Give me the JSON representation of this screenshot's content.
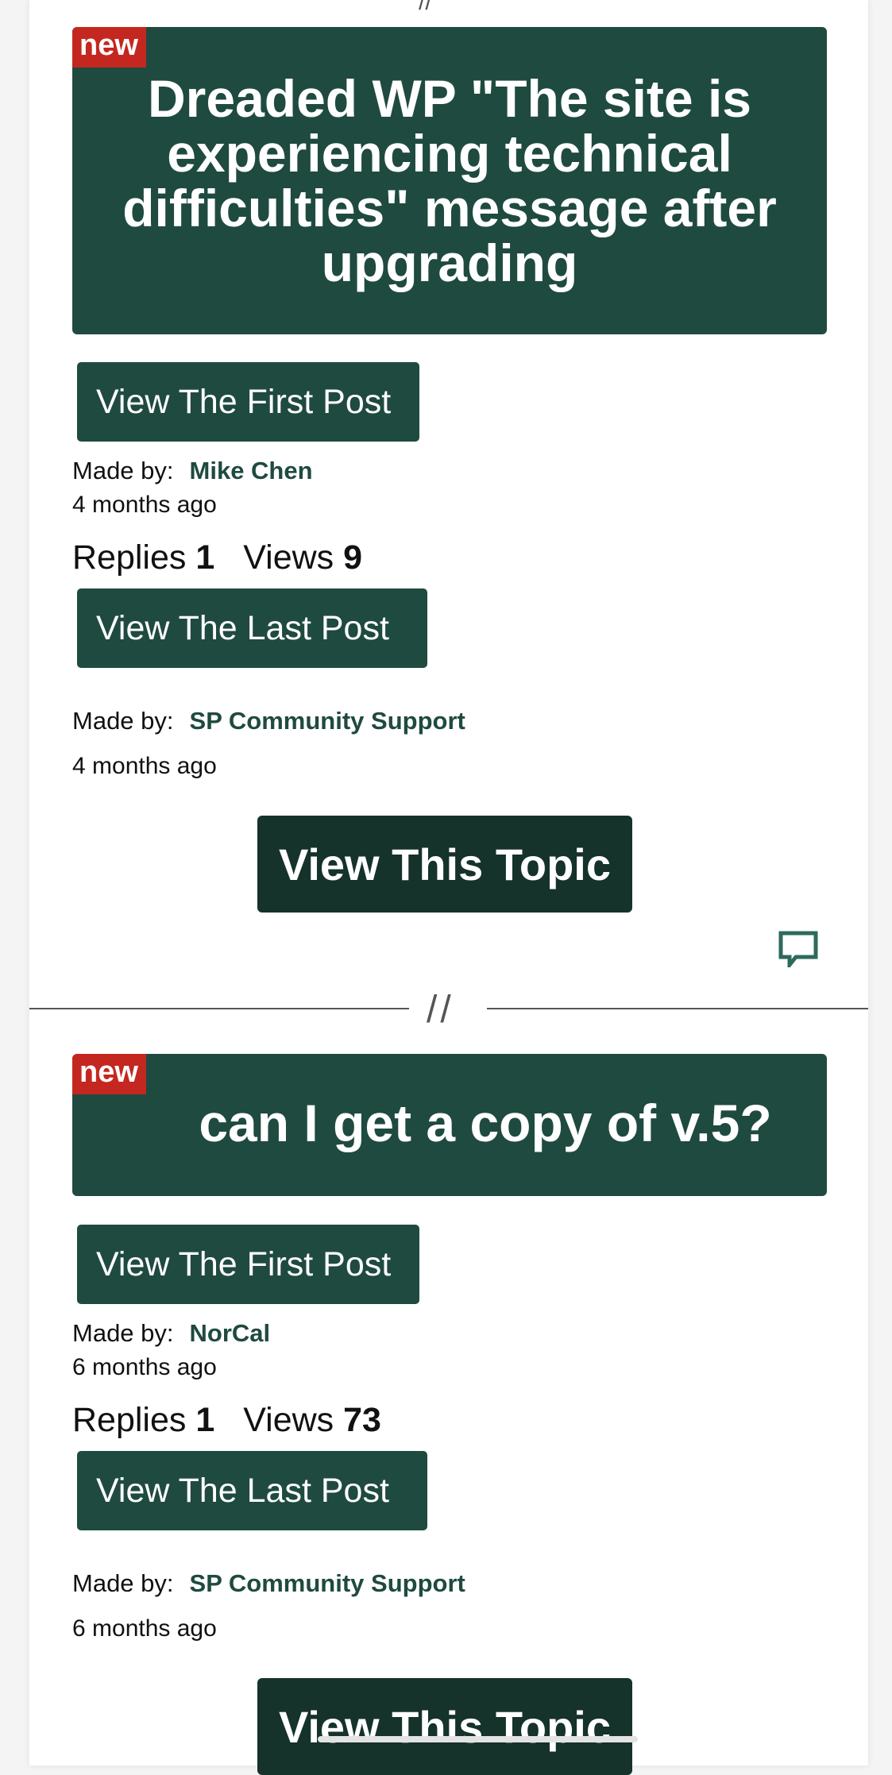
{
  "divider_mark": "//",
  "topics": [
    {
      "badge": "new",
      "title": "Dreaded WP \"The site is experiencing technical difficulties\" message after upgrading",
      "first_post_button": "View The First Post",
      "first_made_by_label": "Made by:",
      "first_author": "Mike Chen",
      "first_time": "4 months ago",
      "replies_label": "Replies",
      "replies": "1",
      "views_label": "Views",
      "views": "9",
      "last_post_button": "View The Last Post",
      "last_made_by_label": "Made by:",
      "last_author": "SP Community Support",
      "last_time": "4 months ago",
      "view_topic_button": "View This Topic"
    },
    {
      "badge": "new",
      "title": "can I get a copy of v.5?",
      "first_post_button": "View The First Post",
      "first_made_by_label": "Made by:",
      "first_author": "NorCal",
      "first_time": "6 months ago",
      "replies_label": "Replies",
      "replies": "1",
      "views_label": "Views",
      "views": "73",
      "last_post_button": "View The Last Post",
      "last_made_by_label": "Made by:",
      "last_author": "SP Community Support",
      "last_time": "6 months ago",
      "view_topic_button": "View This Topic"
    }
  ],
  "icons": {
    "comment": "comment-icon"
  },
  "colors": {
    "primary": "#1f4a40",
    "dark": "#15322b",
    "badge": "#c4271f"
  }
}
